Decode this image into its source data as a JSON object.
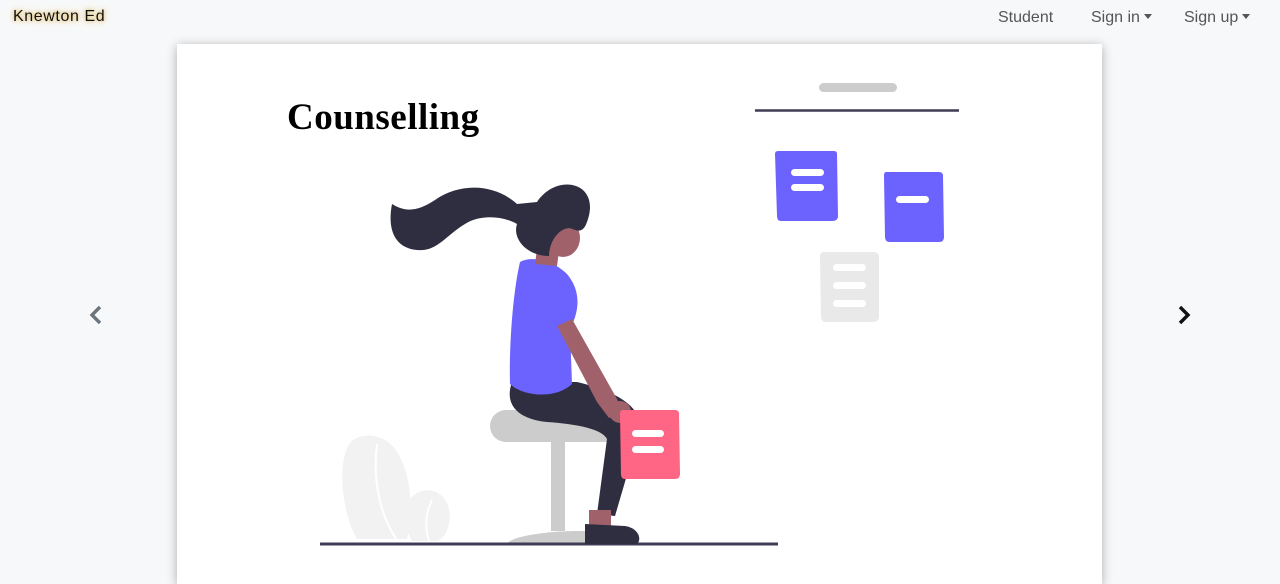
{
  "navbar": {
    "brand": "Knewton Ed",
    "student": "Student",
    "signin": "Sign in",
    "signup": "Sign up"
  },
  "slide": {
    "title": "Counselling"
  },
  "colors": {
    "accent": "#6c63ff",
    "note_pink": "#ff6584",
    "dark": "#2f2e41",
    "skin": "#a0616a",
    "gray": "#cccccc"
  },
  "icons": [
    "chevron-left-icon",
    "chevron-right-icon",
    "caret-down-icon"
  ]
}
